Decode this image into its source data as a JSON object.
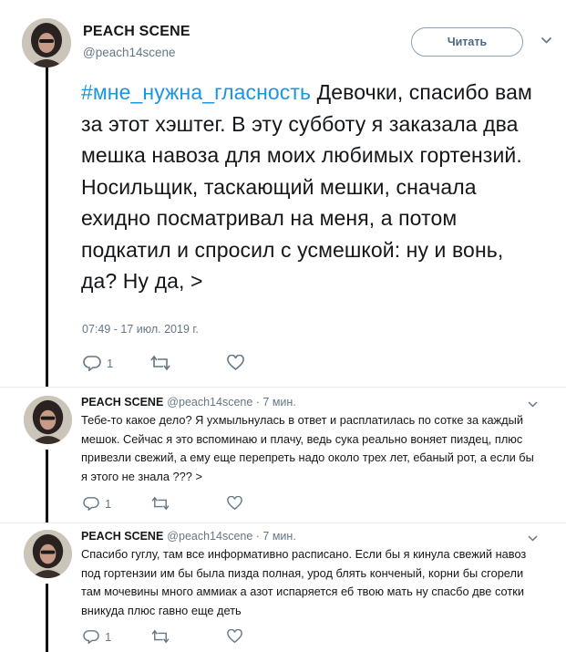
{
  "main_tweet": {
    "name": "PEACH SCENE",
    "handle": "@peach14scene",
    "follow_label": "Читать",
    "hashtag": "#мне_нужна_гласность",
    "text": " Девочки, спасибо вам за этот хэштег. В эту субботу я заказала два мешка навоза для моих любимых гортензий. Носильщик, таскающий мешки, сначала ехидно посматривал на меня, а потом подкатил и спросил с усмешкой: ну и вонь, да? Ну да, >",
    "timestamp": "07:49 - 17 июл. 2019 г.",
    "reply_count": "1"
  },
  "replies": [
    {
      "name": "PEACH SCENE",
      "meta": "@peach14scene · 7 мин.",
      "text": "Тебе-то какое дело? Я ухмыльнулась в ответ и расплатилась по сотке за каждый мешок. Сейчас я это вспоминаю и плачу, ведь сука реально воняет пиздец, плюс привезли свежий, а ему еще перепреть надо около трех лет, ебаный рот, а если бы я этого не знала ??? >",
      "reply_count": "1"
    },
    {
      "name": "PEACH SCENE",
      "meta": "@peach14scene · 7 мин.",
      "text": "Спасибо гуглу, там все информативно расписано. Если бы я кинула свежий навоз под гортензии им бы была пизда полная, урод блять конченый, корни бы сгорели там мочевины много аммиак а азот испаряется еб твою мать ну спасбо две сотки вникуда плюс гавно еще деть",
      "reply_count": "1"
    }
  ],
  "icons": {
    "reply": "reply-icon",
    "retweet": "retweet-icon",
    "like": "heart-icon",
    "menu": "chevron-down-icon"
  },
  "colors": {
    "hashtag": "#1b95e0",
    "meta_gray": "#657786",
    "thread_line": "#111111",
    "separator": "#e6ecf0"
  }
}
